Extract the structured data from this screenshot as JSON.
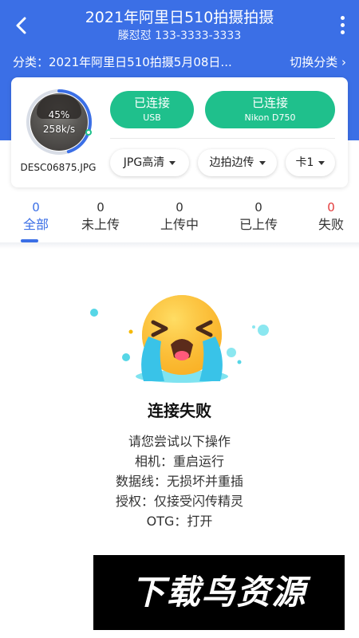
{
  "header": {
    "title": "2021年阿里日510拍摄拍摄",
    "subtitle": "滕怼怼 133-3333-3333",
    "back_icon": "back-chevron-icon",
    "more_icon": "more-vertical-icon"
  },
  "category": {
    "text": "分类：2021年阿里日510拍摄5月08日...",
    "switch_label": "切换分类 ›"
  },
  "transfer": {
    "progress_percent": 45,
    "percent_label": "45%",
    "speed_label": "258k/s",
    "filename": "DESC06875.JPG"
  },
  "connections": {
    "usb": {
      "status": "已连接",
      "type": "USB"
    },
    "camera": {
      "status": "已连接",
      "type": "Nikon D750"
    }
  },
  "dropdowns": {
    "quality": "JPG高清",
    "mode": "边拍边传",
    "card": "卡1"
  },
  "tabs": [
    {
      "count": "0",
      "label": "全部"
    },
    {
      "count": "0",
      "label": "未上传"
    },
    {
      "count": "0",
      "label": "上传中"
    },
    {
      "count": "0",
      "label": "已上传"
    },
    {
      "count": "0",
      "label": "失败"
    }
  ],
  "empty_state": {
    "title": "连接失败",
    "hints": [
      "请您尝试以下操作",
      "相机：重启运行",
      "数据线：无损坏并重插",
      "授权：仅接受闪传精灵",
      "OTG：打开"
    ]
  },
  "watermark": "下载鸟资源",
  "colors": {
    "primary": "#3b6fe6",
    "connected_green": "#1fc08c",
    "fail_red": "#e33b3b"
  }
}
